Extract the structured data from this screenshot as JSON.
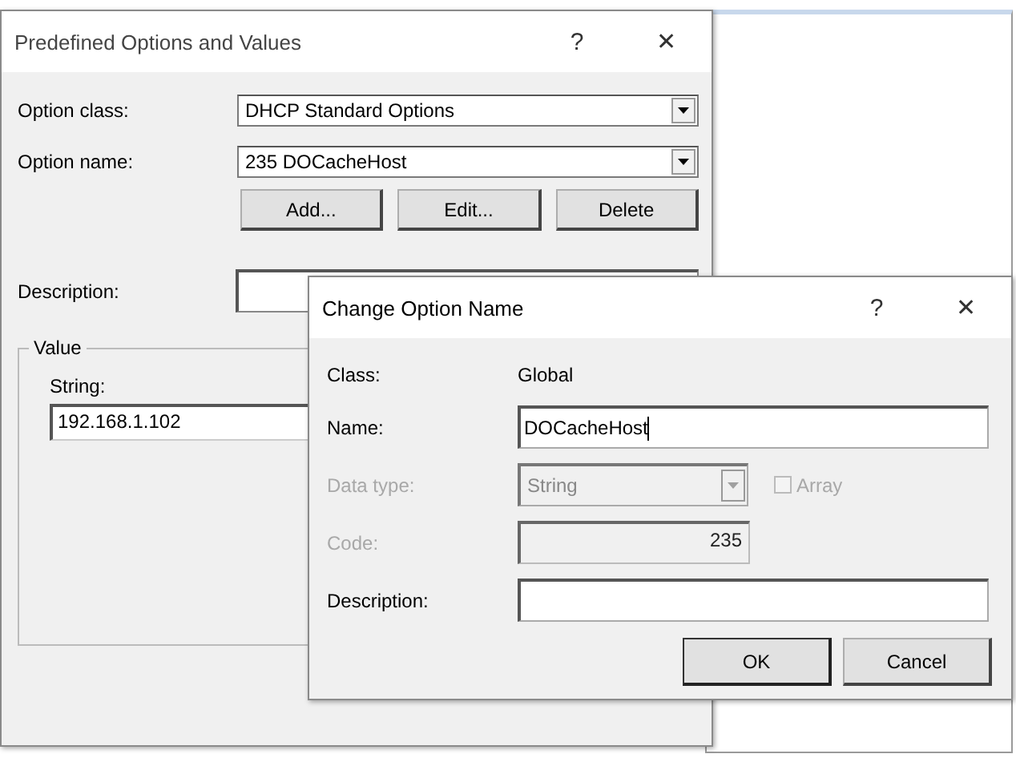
{
  "back_dialog": {
    "title": "Predefined Options and Values",
    "help": "?",
    "close": "✕",
    "option_class": {
      "label": "Option class:",
      "value": "DHCP Standard Options"
    },
    "option_name": {
      "label": "Option name:",
      "value": "235 DOCacheHost"
    },
    "buttons": [
      "Add...",
      "Edit...",
      "Delete"
    ],
    "description": {
      "label": "Description:"
    },
    "value_group": {
      "title": "Value",
      "string_label": "String:",
      "string_value": "192.168.1.102"
    }
  },
  "dialog": {
    "title": "Change Option Name",
    "help": "?",
    "close": "✕",
    "rows": [
      {
        "kind": "static",
        "label": "Class:",
        "value": "Global",
        "disabled": false
      },
      {
        "kind": "text",
        "label": "Name:",
        "value": "DOCacheHost",
        "disabled": false,
        "focused": true
      },
      {
        "kind": "combo",
        "label": "Data type:",
        "value": "String",
        "disabled": true,
        "checkbox": {
          "label": "Array",
          "checked": false
        }
      },
      {
        "kind": "number",
        "label": "Code:",
        "value": "235",
        "disabled": true
      },
      {
        "kind": "text",
        "label": "Description:",
        "disabled": false,
        "focused": false
      }
    ],
    "buttons": [
      {
        "label": "OK",
        "default": true
      },
      {
        "label": "Cancel",
        "default": false
      }
    ]
  }
}
